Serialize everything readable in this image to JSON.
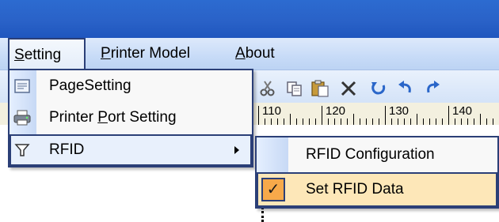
{
  "menubar": {
    "items": [
      {
        "pre": "",
        "acc": "S",
        "post": "etting"
      },
      {
        "pre": "",
        "acc": "P",
        "post": "rinter Model"
      },
      {
        "pre": "",
        "acc": "A",
        "post": "bout"
      }
    ]
  },
  "ruler": {
    "labels": [
      "110",
      "120",
      "130",
      "140"
    ]
  },
  "setting_menu": {
    "items": [
      {
        "pre": "Pa",
        "acc": "g",
        "post": "eSetting",
        "icon": "page-icon"
      },
      {
        "pre": "Printer ",
        "acc": "P",
        "post": "ort Setting",
        "icon": "printer-icon"
      },
      {
        "pre": "RFID",
        "acc": "",
        "post": "",
        "icon": "funnel-icon"
      }
    ]
  },
  "rfid_submenu": {
    "items": [
      {
        "label": "RFID Configuration",
        "checked": false
      },
      {
        "label": "Set RFID Data",
        "checked": true
      }
    ]
  },
  "colors": {
    "titlebar": "#2a62c8",
    "menu_border": "#2b3f77",
    "checked_bg": "#f7a94a",
    "highlight_bg": "#fde7b8"
  }
}
